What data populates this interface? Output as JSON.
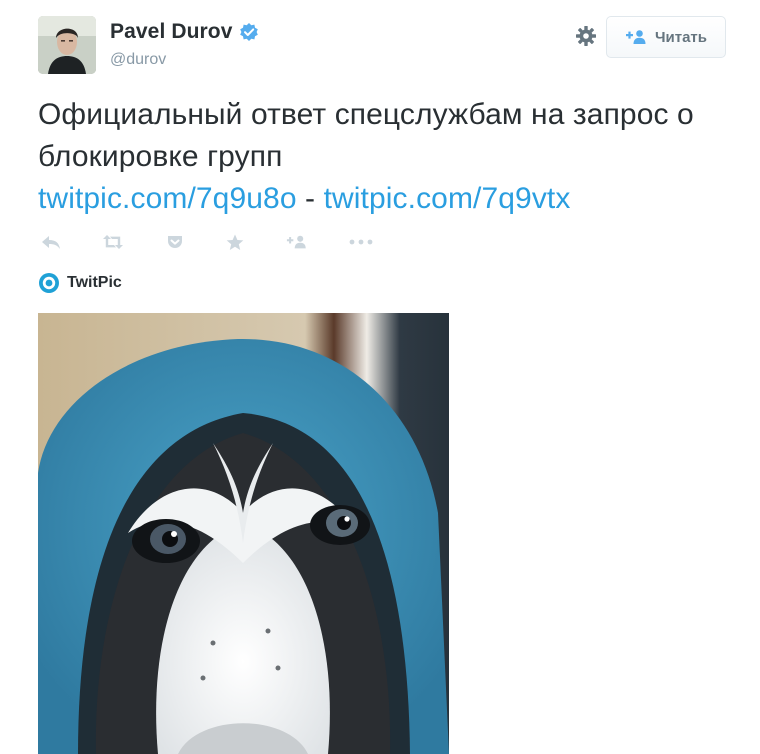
{
  "user": {
    "display_name": "Pavel Durov",
    "handle": "@durov",
    "verified": true,
    "avatar_icon": "avatar-photo"
  },
  "follow_button": {
    "label": "Читать",
    "icon": "follow-person-icon"
  },
  "settings_icon": "gear-icon",
  "tweet": {
    "text_line": "Официальный ответ спецслужбам на запрос о блокировке групп",
    "link1": "twitpic.com/7q9u8o",
    "separator": "-",
    "link2": "twitpic.com/7q9vtx"
  },
  "actions": [
    "reply-icon",
    "retweet-icon",
    "pocket-icon",
    "favorite-icon",
    "follow-icon",
    "more-icon"
  ],
  "card": {
    "source": "TwitPic",
    "source_icon": "twitpic-logo-icon",
    "image_alt_icon": "husky-in-hoodie-photo"
  },
  "colors": {
    "link": "#2a9ee0",
    "verified": "#55acee",
    "muted": "#8899a6",
    "action_icons": "#ccd6dd",
    "hoodie": "#3b88ad"
  }
}
